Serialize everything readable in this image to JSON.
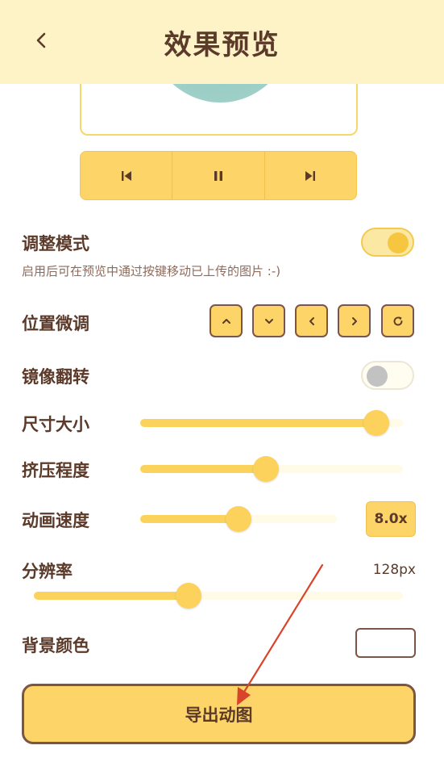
{
  "header": {
    "title": "效果预览",
    "back_icon": "chevron-left-icon"
  },
  "playback": {
    "buttons": [
      "skip-previous-icon",
      "pause-icon",
      "skip-next-icon"
    ]
  },
  "adjust_mode": {
    "label": "调整模式",
    "hint": "启用后可在预览中通过按键移动已上传的图片 :-)",
    "enabled": true
  },
  "position": {
    "label": "位置微调",
    "buttons": [
      "chevron-up-icon",
      "chevron-down-icon",
      "chevron-left-icon",
      "chevron-right-icon",
      "refresh-icon"
    ]
  },
  "mirror": {
    "label": "镜像翻转",
    "enabled": false
  },
  "size": {
    "label": "尺寸大小",
    "value": 0.9
  },
  "squeeze": {
    "label": "挤压程度",
    "value": 0.48
  },
  "speed": {
    "label": "动画速度",
    "value": 0.5,
    "display": "8.0x"
  },
  "resolution": {
    "label": "分辨率",
    "value": 0.42,
    "display": "128px"
  },
  "background": {
    "label": "背景颜色",
    "color": "#ffffff"
  },
  "export": {
    "label": "导出动图"
  },
  "colors": {
    "accent": "#fdd468",
    "text": "#5b3a2a",
    "header_bg": "#fdf3c7",
    "annotation_arrow": "#d9452b"
  }
}
